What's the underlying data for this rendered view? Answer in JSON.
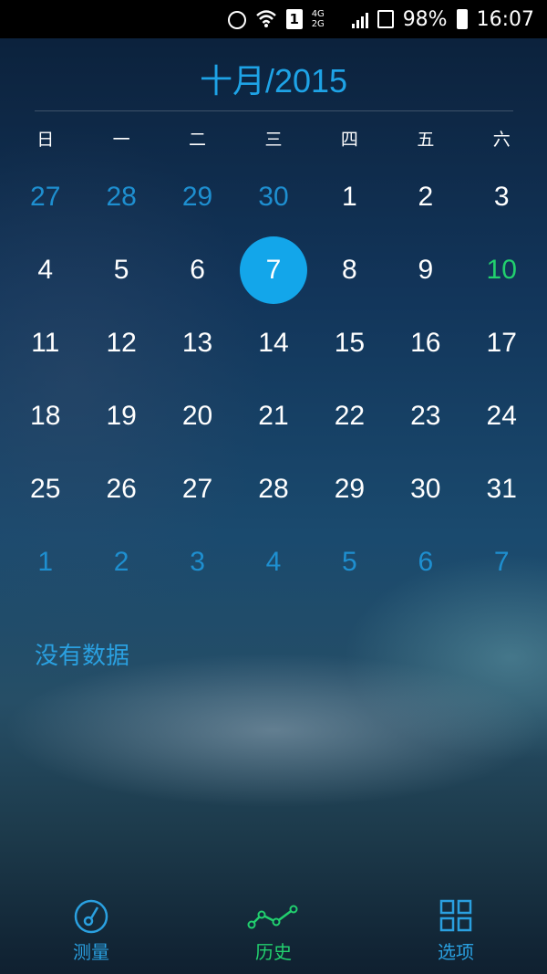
{
  "status_bar": {
    "net_top": "4G",
    "net_bottom": "2G",
    "sim": "1",
    "battery": "98%",
    "time": "16:07"
  },
  "calendar": {
    "title": "十月/2015",
    "weekdays": [
      "日",
      "一",
      "二",
      "三",
      "四",
      "五",
      "六"
    ],
    "selected_day": "7",
    "weeks": [
      [
        "27",
        "28",
        "29",
        "30",
        "1",
        "2",
        "3"
      ],
      [
        "4",
        "5",
        "6",
        "7",
        "8",
        "9",
        "10"
      ],
      [
        "11",
        "12",
        "13",
        "14",
        "15",
        "16",
        "17"
      ],
      [
        "18",
        "19",
        "20",
        "21",
        "22",
        "23",
        "24"
      ],
      [
        "25",
        "26",
        "27",
        "28",
        "29",
        "30",
        "31"
      ],
      [
        "1",
        "2",
        "3",
        "4",
        "5",
        "6",
        "7"
      ]
    ]
  },
  "message": "没有数据",
  "tabs": [
    {
      "label": "测量",
      "icon": "gauge-icon"
    },
    {
      "label": "历史",
      "icon": "line-chart-icon"
    },
    {
      "label": "选项",
      "icon": "grid-icon"
    }
  ],
  "colors": {
    "accent": "#13a6ea",
    "active_green": "#22d06e",
    "other_month": "#1e8fd0"
  }
}
